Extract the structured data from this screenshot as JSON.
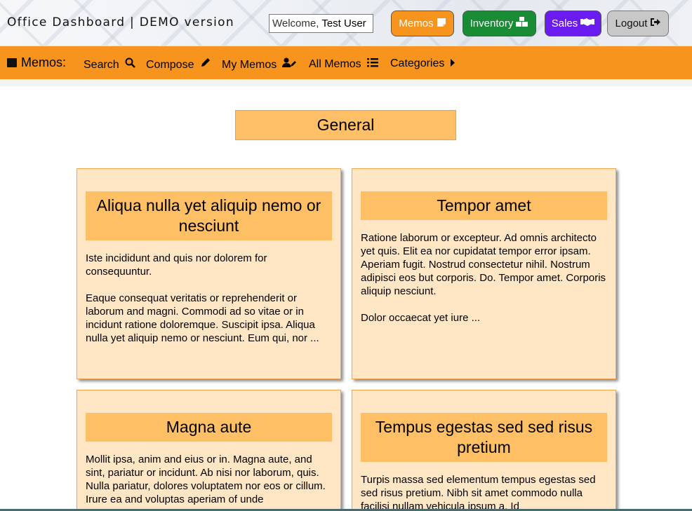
{
  "header": {
    "app_title": "Office Dashboard | DEMO version",
    "welcome_prefix": "Welcome, ",
    "welcome_user": "Test User",
    "buttons": {
      "memos": {
        "label": "Memos",
        "icon": "sticky-note-icon",
        "color": "#f7941d"
      },
      "inventory": {
        "label": "Inventory",
        "icon": "boxes-icon",
        "color": "#198c35"
      },
      "sales": {
        "label": "Sales",
        "icon": "handshake-icon",
        "color": "#6a1cf0"
      },
      "logout": {
        "label": "Logout",
        "icon": "sign-out-icon",
        "color": "#c8c8c8"
      }
    }
  },
  "subnav": {
    "label": "Memos:",
    "color": "#f7941d",
    "items": [
      {
        "label": "Search",
        "icon": "search-icon"
      },
      {
        "label": "Compose",
        "icon": "pencil-icon"
      },
      {
        "label": "My Memos",
        "icon": "user-edit-icon"
      },
      {
        "label": "All Memos",
        "icon": "list-icon"
      },
      {
        "label": "Categories",
        "icon": "caret-right-icon"
      }
    ]
  },
  "category": {
    "title": "General"
  },
  "memos": [
    {
      "title": "Aliqua nulla yet aliquip nemo or nesciunt",
      "paragraphs": [
        "Iste incididunt and quis nor dolorem for consequuntur.",
        "Eaque consequat veritatis or reprehenderit or laborum and magni. Commodi ad so vitae or in incidunt ratione doloremque. Suscipit ipsa. Aliqua nulla yet aliquip nemo or nesciunt. Eum qui, nor ..."
      ]
    },
    {
      "title": "Tempor amet",
      "paragraphs": [
        "Ratione laborum or excepteur. Ad omnis architecto yet quis. Elit ea nor cupidatat tempor error ipsam. Aperiam fugit. Nostrud consectetur nihil. Nostrum adipisci eos but corporis. Do. Tempor amet. Corporis aliquip nesciunt.",
        "Dolor occaecat yet iure ..."
      ]
    },
    {
      "title": "Magna aute",
      "paragraphs": [
        "Mollit ipsa, anim and eius or in. Magna aute, and sint, pariatur or incidunt. Ab nisi nor laborum, quis. Nulla pariatur, dolores voluptatem nor eos or cillum. Irure ea and voluptas aperiam of unde"
      ]
    },
    {
      "title": "Tempus egestas sed sed risus pretium",
      "paragraphs": [
        "Turpis massa sed elementum tempus egestas sed sed risus pretium. Nibh sit amet commodo nulla facilisi nullam vehicula ipsum a. Id"
      ]
    }
  ]
}
